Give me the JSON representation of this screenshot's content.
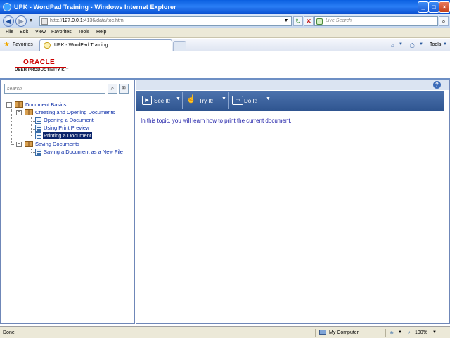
{
  "window": {
    "title": "UPK - WordPad Training - Windows Internet Explorer",
    "controls": {
      "minimize": "_",
      "maximize": "□",
      "close": "×"
    }
  },
  "address_bar": {
    "url_prefix": "http://",
    "url_host": "127.0.0.1",
    "url_rest": ":4136/data/toc.html",
    "search_placeholder": "Live Search"
  },
  "menu": [
    "File",
    "Edit",
    "View",
    "Favorites",
    "Tools",
    "Help"
  ],
  "favorites_bar": {
    "favorites_label": "Favorites",
    "tab_title": "UPK - WordPad Training",
    "tools_label": "Tools"
  },
  "brand": {
    "name": "ORACLE",
    "subtitle": "USER PRODUCTIVITY KIT"
  },
  "toc": {
    "search_placeholder": "search",
    "items": [
      {
        "label": "Document Basics",
        "type": "book",
        "level": 0,
        "selected": false
      },
      {
        "label": "Creating and Opening Documents",
        "type": "book",
        "level": 1,
        "selected": false
      },
      {
        "label": "Opening a Document",
        "type": "topic",
        "level": 2,
        "selected": false
      },
      {
        "label": "Using Print Preview",
        "type": "topic",
        "level": 2,
        "selected": false
      },
      {
        "label": "Printing a Document",
        "type": "topic",
        "level": 2,
        "selected": true
      },
      {
        "label": "Saving Documents",
        "type": "book",
        "level": 1,
        "selected": false
      },
      {
        "label": "Saving a Document as a New File",
        "type": "topic",
        "level": 2,
        "selected": false
      }
    ]
  },
  "modes": [
    {
      "label": "See It!"
    },
    {
      "label": "Try It!"
    },
    {
      "label": "Do It!"
    }
  ],
  "content": {
    "text": "In this topic, you will learn how to print the current document."
  },
  "status_bar": {
    "left": "Done",
    "zone": "My Computer",
    "zoom": "100%"
  }
}
